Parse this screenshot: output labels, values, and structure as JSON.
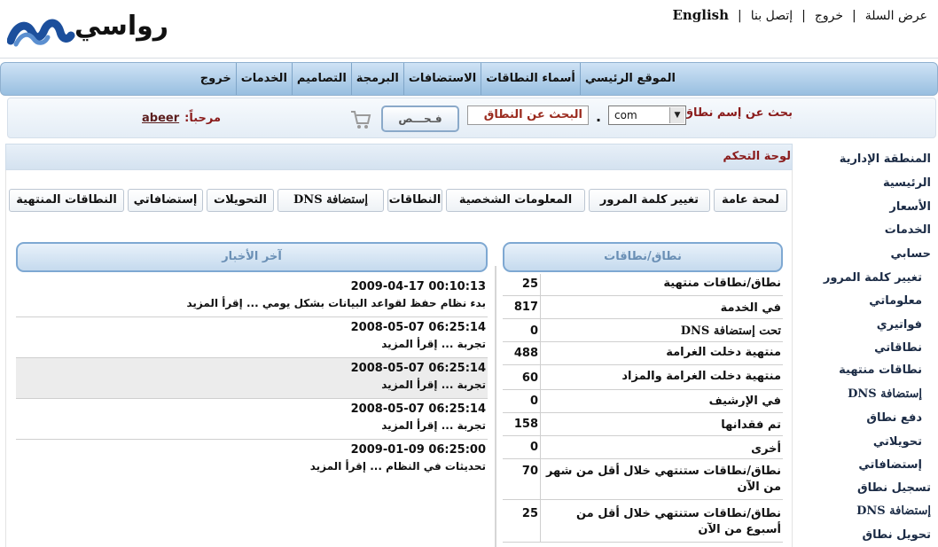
{
  "header": {
    "logo_text": "رواسي",
    "links": [
      "عرض السلة",
      "خروج",
      "إتصل بنا",
      "English"
    ]
  },
  "main_nav": [
    "الموقع الرئيسي",
    "أسماء النطاقات",
    "الاستضافات",
    "البرمجة",
    "التصاميم",
    "الخدمات",
    "خروج"
  ],
  "search": {
    "label": "بحث عن إسم نطاق",
    "tld_selected": "com",
    "domain_value": "البحث عن النطاق",
    "dot": ".",
    "check_button": "فـحـــص",
    "welcome_label": "مرحباً:",
    "username": "abeer"
  },
  "panel": {
    "title": "لوحة التحكم"
  },
  "sidebar": [
    {
      "label": "المنطقة الإدارية",
      "sub": false
    },
    {
      "label": "الرئيسية",
      "sub": false
    },
    {
      "label": "الأسعار",
      "sub": false
    },
    {
      "label": "الخدمات",
      "sub": false
    },
    {
      "label": "حسابي",
      "sub": false
    },
    {
      "label": "تغيير كلمة المرور",
      "sub": true
    },
    {
      "label": "معلوماتي",
      "sub": true
    },
    {
      "label": "فواتيري",
      "sub": true
    },
    {
      "label": "نطاقاتي",
      "sub": true
    },
    {
      "label": "نطاقات منتهية",
      "sub": true
    },
    {
      "label": "إستضافة DNS",
      "sub": true
    },
    {
      "label": "دفع نطاق",
      "sub": true
    },
    {
      "label": "تحويلاتي",
      "sub": true
    },
    {
      "label": "إستضافاتي",
      "sub": true
    },
    {
      "label": "تسجيل نطاق",
      "sub": false
    },
    {
      "label": "إستضافة DNS",
      "sub": false
    },
    {
      "label": "تحويل نطاق",
      "sub": false
    }
  ],
  "tabs": [
    "لمحة عامة",
    "تغيير كلمة المرور",
    "المعلومات الشخصية",
    "النطاقات",
    "إستضافة DNS",
    "التحويلات",
    "إستضافاتي",
    "النطاقات المنتهية"
  ],
  "domains_section": {
    "title": "نطاق/نطاقات",
    "rows": [
      {
        "label": "نطاق/نطاقات منتهية",
        "value": "25"
      },
      {
        "label": "في الخدمة",
        "value": "817"
      },
      {
        "label": "تحت إستضافة DNS",
        "value": "0"
      },
      {
        "label": "منتهية دخلت الغرامة",
        "value": "488"
      },
      {
        "label": "منتهية دخلت الغرامة والمزاد",
        "value": "60"
      },
      {
        "label": "في الإرشيف",
        "value": "0"
      },
      {
        "label": "تم فقدانها",
        "value": "158"
      },
      {
        "label": "أخرى",
        "value": "0"
      },
      {
        "label": "نطاق/نطاقات ستنتهي خلال أقل من شهر من الآن",
        "value": "70"
      },
      {
        "label": "نطاق/نطاقات ستنتهي خلال أقل من أسبوع من الآن",
        "value": "25"
      }
    ]
  },
  "news_section": {
    "title": "آخر الأخبار",
    "items": [
      {
        "date": "2009-04-17 00:10:13",
        "text": "بدء نظام حفظ لقواعد البيانات بشكل يومي ...",
        "more": "إقرأ المزيد"
      },
      {
        "date": "2008-05-07 06:25:14",
        "text": "تجربة ...",
        "more": "إقرأ المزيد"
      },
      {
        "date": "2008-05-07 06:25:14",
        "text": "تجربة ...",
        "more": "إقرأ المزيد"
      },
      {
        "date": "2008-05-07 06:25:14",
        "text": "تجربة ...",
        "more": "إقرأ المزيد"
      },
      {
        "date": "2009-01-09 06:25:00",
        "text": "تحديثات في النظام ...",
        "more": "إقرأ المزيد"
      }
    ]
  },
  "colors": {
    "accent_dark_red": "#8a1b1b",
    "nav_blue": "#98bfe0",
    "section_header_text": "#6a8fb5",
    "logo_blue": "#1c4f9c"
  }
}
